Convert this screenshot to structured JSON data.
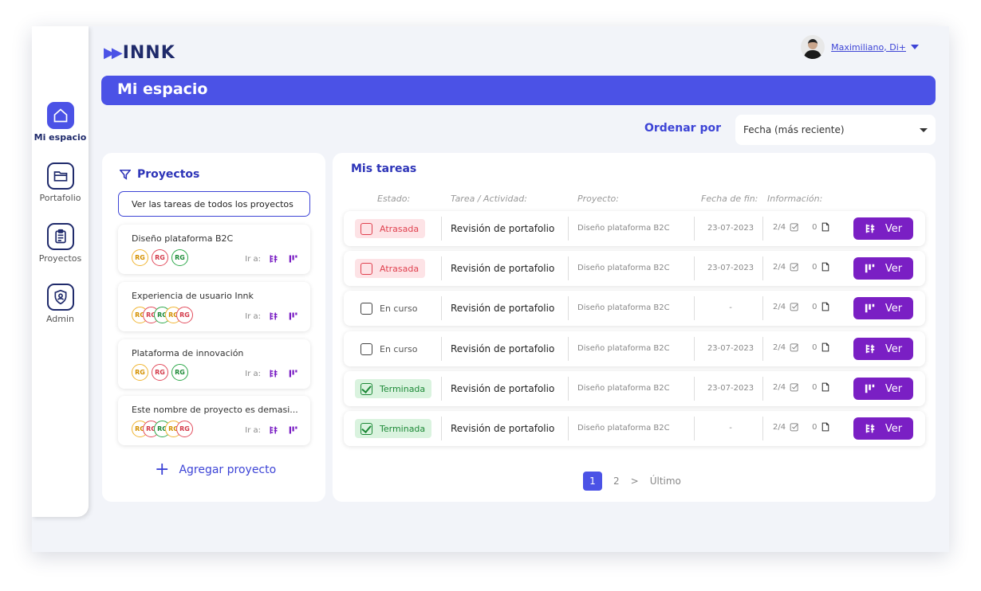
{
  "brand": {
    "name": "INNK",
    "accent": "#4b52e6",
    "purple": "#7a1fc4"
  },
  "user": {
    "name": "Maximiliano, Di+"
  },
  "sidebar": {
    "items": [
      {
        "label": "Mi espacio",
        "icon": "home-icon",
        "active": true
      },
      {
        "label": "Portafolio",
        "icon": "folder-icon"
      },
      {
        "label": "Proyectos",
        "icon": "clipboard-icon"
      },
      {
        "label": "Admin",
        "icon": "shield-user-icon"
      }
    ]
  },
  "page_title": "Mi espacio",
  "sort": {
    "label": "Ordenar por",
    "value": "Fecha (más reciente)"
  },
  "projects": {
    "title": "Proyectos",
    "all_button": "Ver las tareas de todos los proyectos",
    "ira_label": "Ir a:",
    "items": [
      {
        "name": "Diseño plataforma B2C",
        "badges": [
          "RG",
          "RG",
          "RG"
        ]
      },
      {
        "name": "Experiencia de usuario Innk",
        "badges": [
          "RG",
          "RG",
          "RG",
          "RG",
          "RG"
        ]
      },
      {
        "name": "Plataforma de innovación",
        "badges": [
          "RG",
          "RG",
          "RG"
        ]
      },
      {
        "name": "Este nombre de proyecto es demasi...",
        "badges": [
          "RG",
          "RG",
          "RG",
          "RG",
          "RG"
        ]
      }
    ],
    "add_label": "Agregar proyecto"
  },
  "tasks": {
    "title": "Mis tareas",
    "headers": {
      "status": "Estado:",
      "task": "Tarea / Actividad:",
      "project": "Proyecto:",
      "due": "Fecha de fin:",
      "info": "Información:"
    },
    "rows": [
      {
        "status": "Atrasada",
        "task": "Revisión de portafolio",
        "project": "Diseño plataforma B2C",
        "due": "23-07-2023",
        "checks": "2/4",
        "files": "0",
        "button": "Ver",
        "btn_icon": "kanban-icon"
      },
      {
        "status": "Atrasada",
        "task": "Revisión de portafolio",
        "project": "Diseño plataforma B2C",
        "due": "23-07-2023",
        "checks": "2/4",
        "files": "0",
        "button": "Ver",
        "btn_icon": "board-icon"
      },
      {
        "status": "En curso",
        "task": "Revisión de portafolio",
        "project": "Diseño plataforma B2C",
        "due": "-",
        "checks": "2/4",
        "files": "0",
        "button": "Ver",
        "btn_icon": "board-icon"
      },
      {
        "status": "En curso",
        "task": "Revisión de portafolio",
        "project": "Diseño plataforma B2C",
        "due": "23-07-2023",
        "checks": "2/4",
        "files": "0",
        "button": "Ver",
        "btn_icon": "kanban-icon"
      },
      {
        "status": "Terminada",
        "task": "Revisión de portafolio",
        "project": "Diseño plataforma B2C",
        "due": "23-07-2023",
        "checks": "2/4",
        "files": "0",
        "button": "Ver",
        "btn_icon": "board-icon"
      },
      {
        "status": "Terminada",
        "task": "Revisión de portafolio",
        "project": "Diseño plataforma B2C",
        "due": "-",
        "checks": "2/4",
        "files": "0",
        "button": "Ver",
        "btn_icon": "kanban-icon"
      }
    ]
  },
  "pagination": {
    "current": "1",
    "next_page": "2",
    "next": ">",
    "last": "Último"
  }
}
